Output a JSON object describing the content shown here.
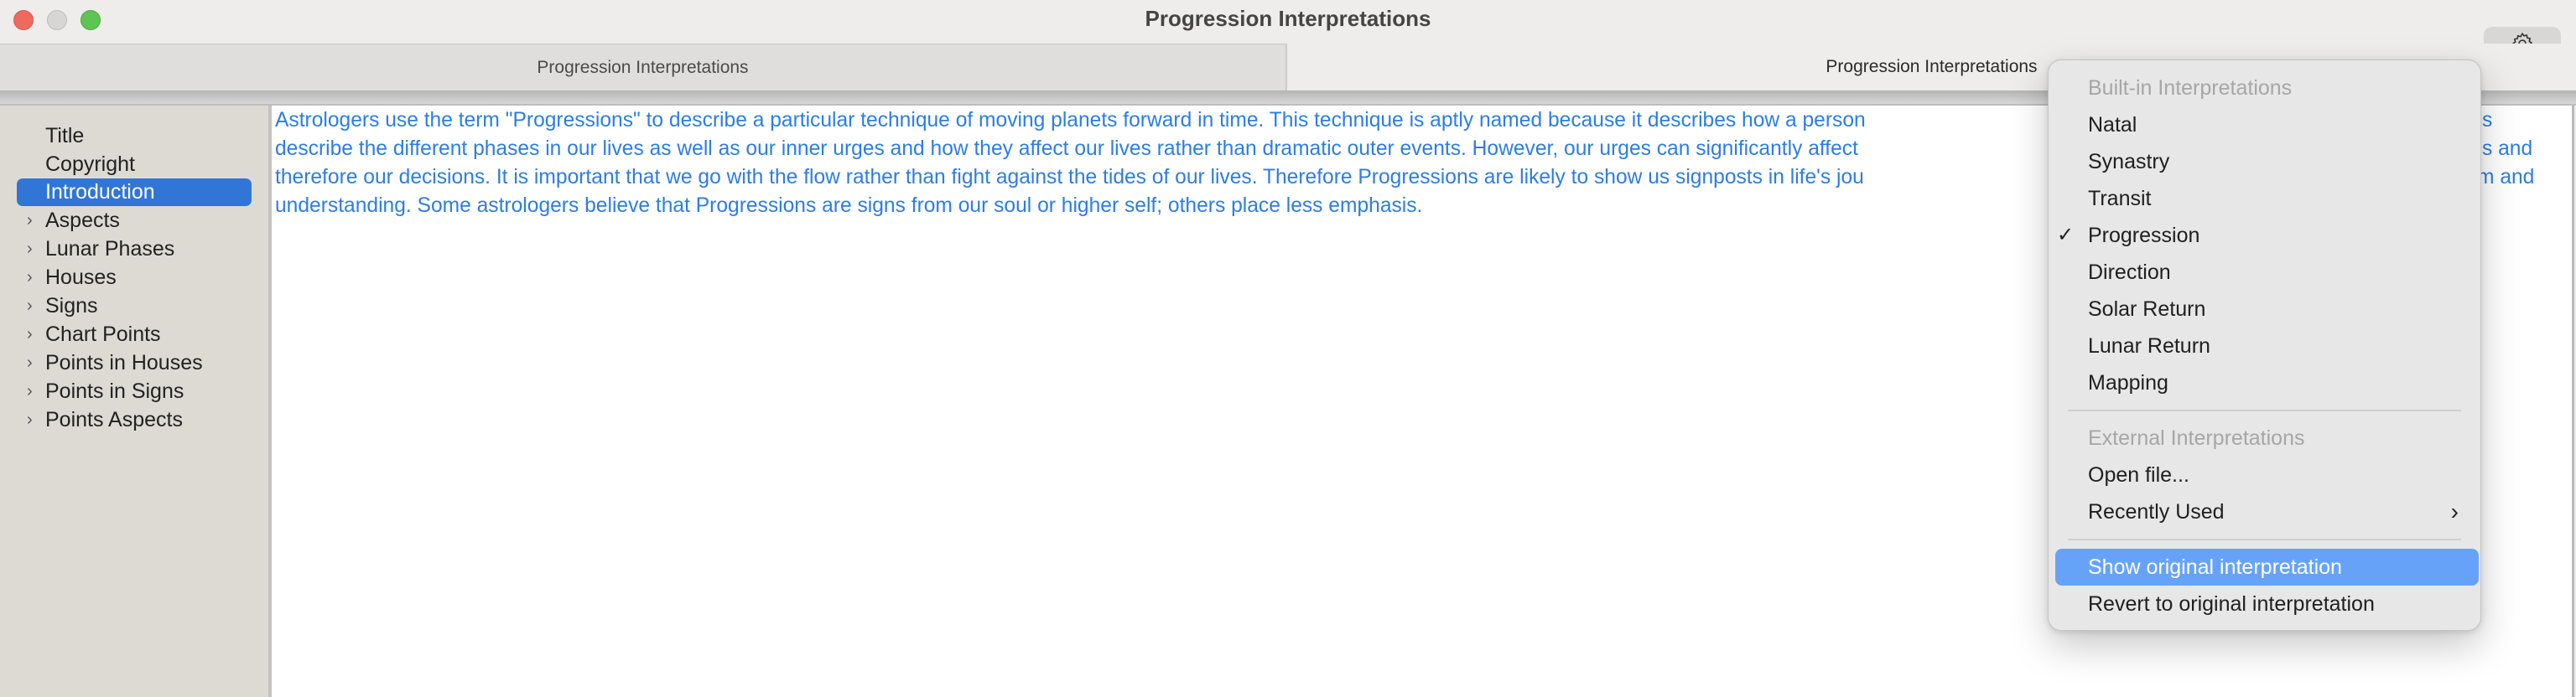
{
  "window": {
    "title": "Progression Interpretations"
  },
  "tabs": [
    {
      "label": "Progression Interpretations",
      "active": false
    },
    {
      "label": "Progression Interpretations",
      "active": true
    }
  ],
  "sidebar": {
    "items": [
      {
        "label": "Title",
        "expandable": false,
        "selected": false
      },
      {
        "label": "Copyright",
        "expandable": false,
        "selected": false
      },
      {
        "label": "Introduction",
        "expandable": false,
        "selected": true
      },
      {
        "label": "Aspects",
        "expandable": true,
        "selected": false
      },
      {
        "label": "Lunar Phases",
        "expandable": true,
        "selected": false
      },
      {
        "label": "Houses",
        "expandable": true,
        "selected": false
      },
      {
        "label": "Signs",
        "expandable": true,
        "selected": false
      },
      {
        "label": "Chart Points",
        "expandable": true,
        "selected": false
      },
      {
        "label": "Points in Houses",
        "expandable": true,
        "selected": false
      },
      {
        "label": "Points in Signs",
        "expandable": true,
        "selected": false
      },
      {
        "label": "Points Aspects",
        "expandable": true,
        "selected": false
      }
    ]
  },
  "content": {
    "lines": [
      {
        "visible": "Astrologers use the term \"Progressions\" to describe a particular technique of moving planets forward in time. This technique is aptly named because it describes how a person",
        "tail": "s"
      },
      {
        "visible": "describe the different phases in our lives as well as our inner urges and how they affect our lives rather than dramatic outer events. However, our urges can significantly affect",
        "tail": "s and"
      },
      {
        "visible": "therefore our decisions. It is important that we go with the flow rather than fight against the tides of our lives. Therefore Progressions are likely to show us signposts in life's jou",
        "tail": "m and"
      },
      {
        "visible": "understanding. Some astrologers believe that Progressions are signs from our soul or higher self; others place less emphasis.",
        "tail": ""
      }
    ],
    "text_color": "#2c7de6"
  },
  "gear_button": {
    "icon": "gear-icon"
  },
  "menu": {
    "sections": [
      {
        "header": "Built-in Interpretations",
        "items": [
          {
            "label": "Natal",
            "checked": false
          },
          {
            "label": "Synastry",
            "checked": false
          },
          {
            "label": "Transit",
            "checked": false
          },
          {
            "label": "Progression",
            "checked": true
          },
          {
            "label": "Direction",
            "checked": false
          },
          {
            "label": "Solar Return",
            "checked": false
          },
          {
            "label": "Lunar Return",
            "checked": false
          },
          {
            "label": "Mapping",
            "checked": false
          }
        ]
      },
      {
        "header": "External Interpretations",
        "items": [
          {
            "label": "Open file...",
            "checked": false
          },
          {
            "label": "Recently Used",
            "submenu": true
          }
        ]
      },
      {
        "items": [
          {
            "label": "Show original interpretation",
            "highlighted": true
          },
          {
            "label": "Revert to original interpretation"
          }
        ]
      }
    ],
    "check_glyph": "✓",
    "submenu_glyph": "›",
    "highlight_color": "#66a3f8"
  },
  "colors": {
    "selection": "#3176d6",
    "sidebar_bg": "#dddad4"
  }
}
